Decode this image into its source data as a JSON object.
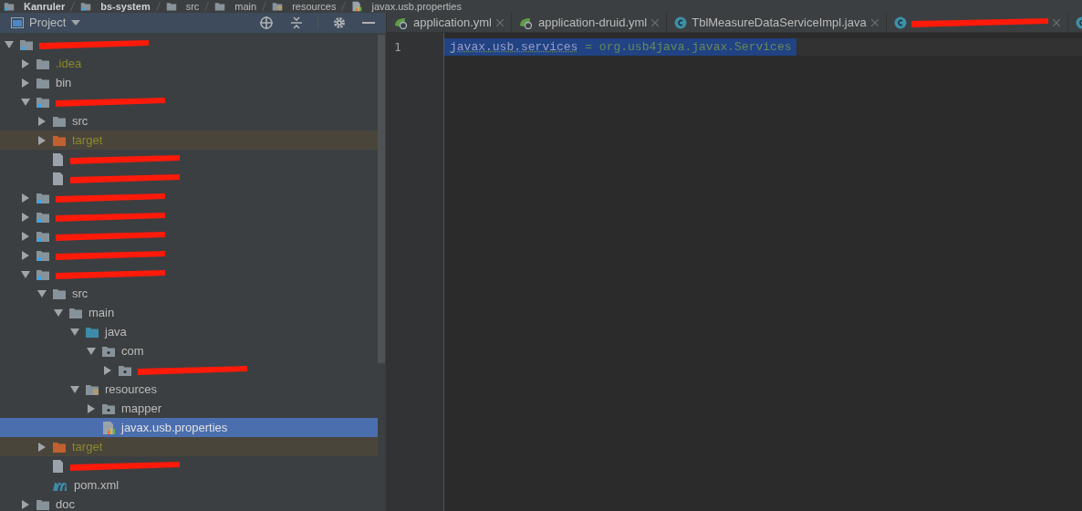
{
  "breadcrumb": [
    {
      "label": "Kanruler",
      "kind": "module"
    },
    {
      "label": "bs-system",
      "kind": "module"
    },
    {
      "label": "src",
      "kind": "folder"
    },
    {
      "label": "main",
      "kind": "folder"
    },
    {
      "label": "resources",
      "kind": "resources"
    },
    {
      "label": "javax.usb.properties",
      "kind": "properties"
    }
  ],
  "project_panel": {
    "title": "Project",
    "tree": [
      {
        "kind": "module",
        "expanded": true,
        "children": [
          {
            "kind": "folder",
            "label": ".idea",
            "excluded": true,
            "expanded": false,
            "highlighted": false
          },
          {
            "kind": "folder",
            "label": "bin",
            "excluded": false,
            "expanded": false,
            "highlighted": false
          },
          {
            "kind": "module",
            "expanded": true,
            "children": [
              {
                "kind": "folder",
                "label": "src",
                "excluded": false,
                "expanded": false,
                "highlighted": false
              },
              {
                "kind": "excluded-folder",
                "label": "target",
                "excluded": true,
                "expanded": false,
                "highlighted": true
              },
              {
                "kind": "file"
              },
              {
                "kind": "file"
              }
            ]
          },
          {
            "kind": "module",
            "expanded": false
          },
          {
            "kind": "module",
            "expanded": false
          },
          {
            "kind": "module",
            "expanded": false
          },
          {
            "kind": "module",
            "expanded": false
          },
          {
            "kind": "module",
            "expanded": true,
            "children": [
              {
                "kind": "folder",
                "label": "src",
                "excluded": false,
                "expanded": true,
                "highlighted": false,
                "children": [
                  {
                    "kind": "folder",
                    "label": "main",
                    "excluded": false,
                    "expanded": true,
                    "highlighted": false,
                    "children": [
                      {
                        "kind": "source-folder",
                        "label": "java",
                        "excluded": false,
                        "expanded": true,
                        "highlighted": false,
                        "children": [
                          {
                            "kind": "package",
                            "label": "com",
                            "excluded": false,
                            "expanded": true,
                            "highlighted": false,
                            "children": [
                              {
                                "kind": "package",
                                "expanded": false
                              }
                            ]
                          }
                        ]
                      },
                      {
                        "kind": "resources",
                        "label": "resources",
                        "excluded": false,
                        "expanded": true,
                        "highlighted": false,
                        "children": [
                          {
                            "kind": "package",
                            "label": "mapper",
                            "excluded": false,
                            "expanded": false,
                            "highlighted": false
                          },
                          {
                            "kind": "properties",
                            "label": "javax.usb.properties",
                            "excluded": false,
                            "selected": true,
                            "highlighted": false
                          }
                        ]
                      }
                    ]
                  }
                ]
              },
              {
                "kind": "excluded-folder",
                "label": "target",
                "excluded": true,
                "expanded": false,
                "highlighted": true
              },
              {
                "kind": "file"
              },
              {
                "kind": "maven",
                "label": "pom.xml",
                "excluded": false,
                "highlighted": false
              }
            ]
          },
          {
            "kind": "folder",
            "label": "doc",
            "excluded": false,
            "expanded": false,
            "highlighted": false
          }
        ]
      }
    ]
  },
  "tabs": [
    {
      "kind": "spring",
      "label": "application.yml",
      "closable": true
    },
    {
      "kind": "spring",
      "label": "application-druid.yml",
      "closable": true
    },
    {
      "kind": "class",
      "label": "TblMeasureDataServiceImpl.java",
      "closable": true
    },
    {
      "kind": "class",
      "closable": true
    },
    {
      "kind": "class",
      "closable": false
    }
  ],
  "editor": {
    "lines": [
      {
        "number": "1",
        "key": "javax.usb.services",
        "separator": " = ",
        "value": "org.usb4java.javax.Services",
        "selected": true
      }
    ]
  }
}
